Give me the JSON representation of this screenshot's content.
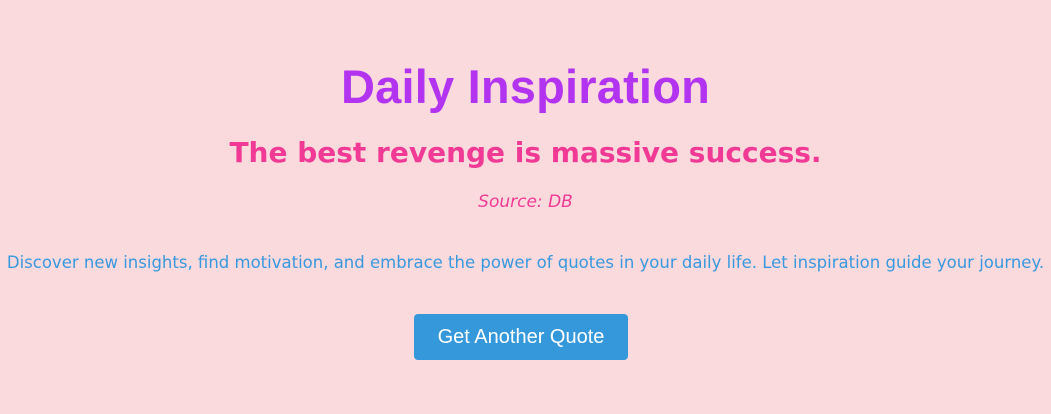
{
  "page": {
    "title": "Daily Inspiration",
    "quote": "The best revenge is massive success.",
    "source": "Source: DB",
    "description": "Discover new insights, find motivation, and embrace the power of quotes in your daily life. Let inspiration guide your journey.",
    "button_label": "Get Another Quote"
  },
  "colors": {
    "background": "#fadadd",
    "title": "#b234f0",
    "quote": "#f03a95",
    "description": "#3a98de",
    "button": "#3498db",
    "button_text": "#ffffff"
  }
}
